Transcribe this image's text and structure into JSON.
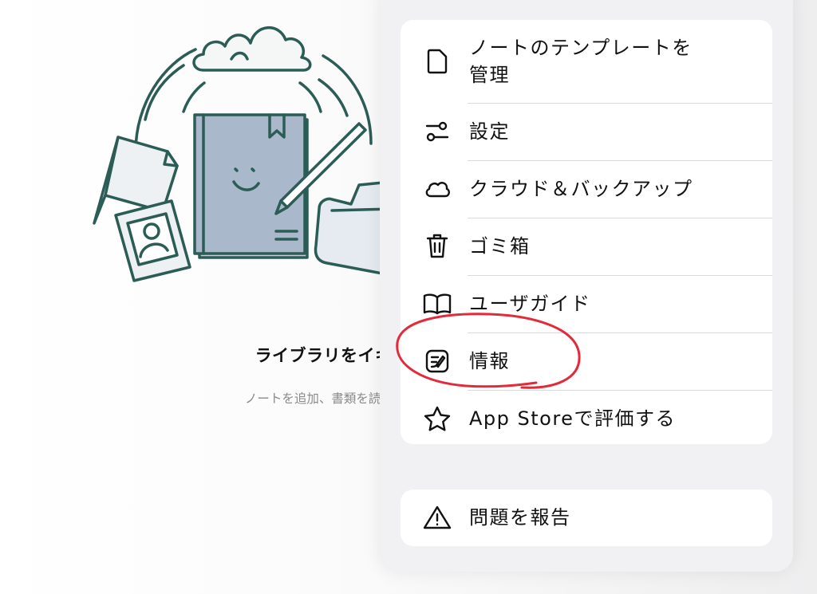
{
  "empty_state": {
    "title": "ライブラリをイキイキとさせたいです",
    "subtitle": "ノートを追加、書類を読み込む、フォルダを作成して、"
  },
  "menu": {
    "items": [
      {
        "label": "ノートのテンプレートを\n管理",
        "icon": "document-icon"
      },
      {
        "label": "設定",
        "icon": "settings-sliders-icon"
      },
      {
        "label": "クラウド＆バックアップ",
        "icon": "cloud-icon"
      },
      {
        "label": "ゴミ箱",
        "icon": "trash-icon"
      },
      {
        "label": "ユーザガイド",
        "icon": "book-icon"
      },
      {
        "label": "情報",
        "icon": "app-info-icon"
      },
      {
        "label": "App Storeで評価する",
        "icon": "star-icon"
      }
    ],
    "report": {
      "label": "問題を報告",
      "icon": "warning-icon"
    }
  },
  "colors": {
    "illustration_stroke": "#2b5c55",
    "notebook_fill": "#a9b8ca",
    "highlight_red": "#e22a3a",
    "menu_background": "#f1f1f4"
  }
}
